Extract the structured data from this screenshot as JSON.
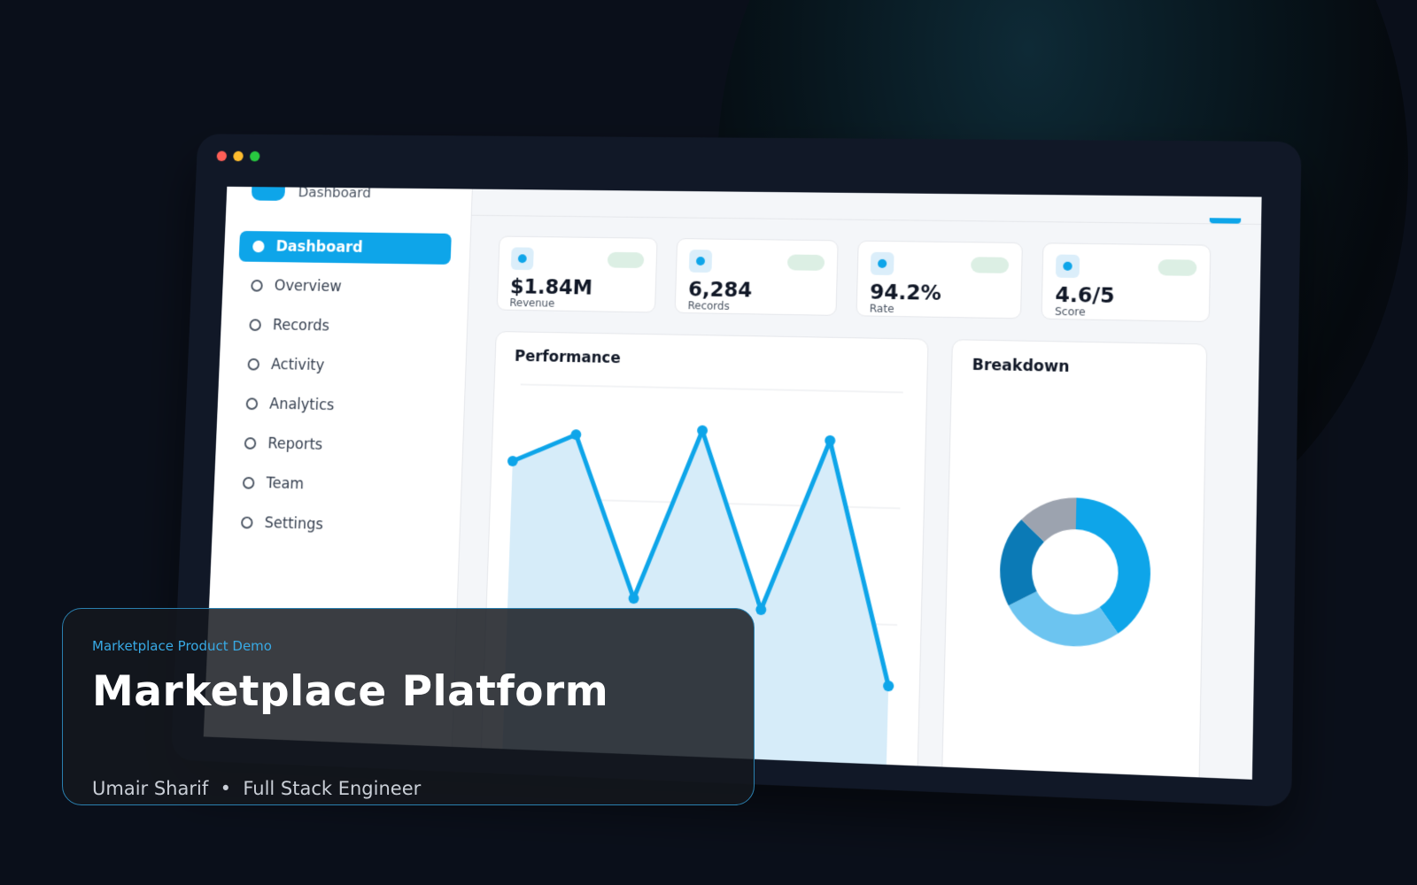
{
  "window": {
    "dot_colors": [
      "#ff5f57",
      "#febc2e",
      "#28c840"
    ]
  },
  "sidebar": {
    "brand_label": "Dashboard",
    "items": [
      {
        "label": "Dashboard",
        "active": true
      },
      {
        "label": "Overview",
        "active": false
      },
      {
        "label": "Records",
        "active": false
      },
      {
        "label": "Activity",
        "active": false
      },
      {
        "label": "Analytics",
        "active": false
      },
      {
        "label": "Reports",
        "active": false
      },
      {
        "label": "Team",
        "active": false
      },
      {
        "label": "Settings",
        "active": false
      }
    ]
  },
  "stats": [
    {
      "value": "$1.84M",
      "label": "Revenue"
    },
    {
      "value": "6,284",
      "label": "Records"
    },
    {
      "value": "94.2%",
      "label": "Rate"
    },
    {
      "value": "4.6/5",
      "label": "Score"
    }
  ],
  "performance": {
    "title": "Performance",
    "values": [
      78,
      86,
      40,
      88,
      38,
      86,
      18
    ],
    "ylim": [
      0,
      100
    ],
    "line_color": "#0ea5e9",
    "fill_color": "#d6ecf9"
  },
  "breakdown": {
    "title": "Breakdown",
    "segments": [
      {
        "value": 40,
        "color": "#0ea5e9"
      },
      {
        "value": 27,
        "color": "#6cc4f0"
      },
      {
        "value": 20,
        "color": "#0b7ab6"
      },
      {
        "value": 13,
        "color": "#9ca3af"
      }
    ]
  },
  "info_card": {
    "kicker": "Marketplace Product Demo",
    "title": "Marketplace Platform",
    "author": "Umair Sharif",
    "separator": "•",
    "role": "Full Stack Engineer"
  },
  "colors": {
    "accent": "#0ea5e9",
    "background": "#0a0f1a",
    "card_border": "#2a7fae"
  }
}
